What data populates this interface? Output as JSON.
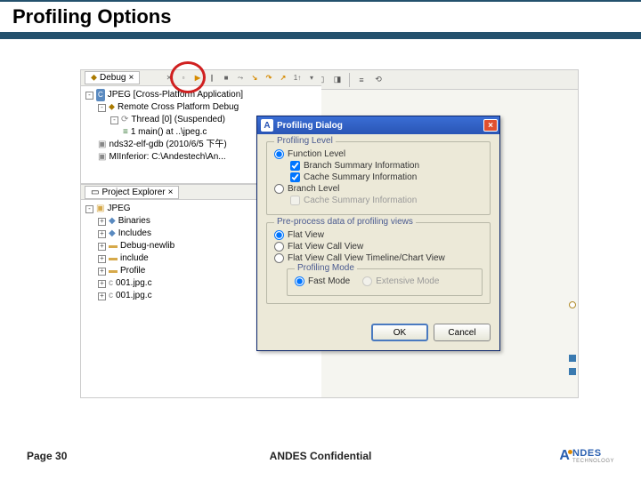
{
  "slide": {
    "title": "Profiling Options",
    "page": "Page 30",
    "confidential": "ANDES Confidential",
    "logo_name": "NDES",
    "logo_sub": "TECHNOLOGY"
  },
  "ide": {
    "debug_tab": "Debug",
    "proj_tab": "Project Explorer",
    "tree": {
      "root": "JPEG [Cross-Platform Application]",
      "remote": "Remote Cross Platform Debug",
      "thread": "Thread [0] (Suspended)",
      "frame": "1 main() at ..\\jpeg.c",
      "gdb": "nds32-elf-gdb (2010/6/5 下午)",
      "inferior": "MIInferior: C:\\Andestech\\An..."
    },
    "project": {
      "root": "JPEG",
      "binaries": "Binaries",
      "includes": "Includes",
      "debug": "Debug-newlib",
      "include": "include",
      "profile": "Profile",
      "f1": "001.jpg.c",
      "f2": "001.jpg.c"
    }
  },
  "dialog": {
    "title": "Profiling Dialog",
    "icon": "A",
    "level_legend": "Profiling Level",
    "func_level": "Function Level",
    "branch_summary": "Branch Summary Information",
    "cache_summary": "Cache Summary Information",
    "branch_level": "Branch Level",
    "cache_summary2": "Cache Summary Information",
    "pre_legend": "Pre-process data of profiling views",
    "flat_view": "Flat View",
    "flat_call": "Flat View   Call View",
    "flat_call_tl": "Flat View   Call View   Timeline/Chart View",
    "mode_legend": "Profiling Mode",
    "fast_mode": "Fast Mode",
    "ext_mode": "Extensive Mode",
    "ok": "OK",
    "cancel": "Cancel"
  }
}
